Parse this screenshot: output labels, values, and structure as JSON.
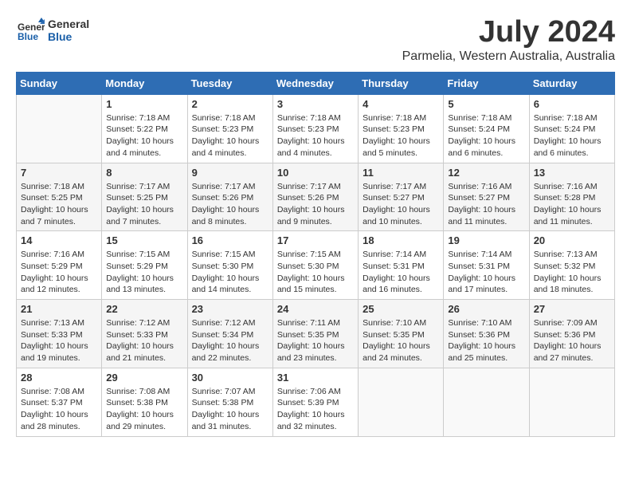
{
  "header": {
    "logo_line1": "General",
    "logo_line2": "Blue",
    "title": "July 2024",
    "subtitle": "Parmelia, Western Australia, Australia"
  },
  "weekdays": [
    "Sunday",
    "Monday",
    "Tuesday",
    "Wednesday",
    "Thursday",
    "Friday",
    "Saturday"
  ],
  "weeks": [
    [
      {
        "day": "",
        "info": ""
      },
      {
        "day": "1",
        "info": "Sunrise: 7:18 AM\nSunset: 5:22 PM\nDaylight: 10 hours\nand 4 minutes."
      },
      {
        "day": "2",
        "info": "Sunrise: 7:18 AM\nSunset: 5:23 PM\nDaylight: 10 hours\nand 4 minutes."
      },
      {
        "day": "3",
        "info": "Sunrise: 7:18 AM\nSunset: 5:23 PM\nDaylight: 10 hours\nand 4 minutes."
      },
      {
        "day": "4",
        "info": "Sunrise: 7:18 AM\nSunset: 5:23 PM\nDaylight: 10 hours\nand 5 minutes."
      },
      {
        "day": "5",
        "info": "Sunrise: 7:18 AM\nSunset: 5:24 PM\nDaylight: 10 hours\nand 6 minutes."
      },
      {
        "day": "6",
        "info": "Sunrise: 7:18 AM\nSunset: 5:24 PM\nDaylight: 10 hours\nand 6 minutes."
      }
    ],
    [
      {
        "day": "7",
        "info": "Sunrise: 7:18 AM\nSunset: 5:25 PM\nDaylight: 10 hours\nand 7 minutes."
      },
      {
        "day": "8",
        "info": "Sunrise: 7:17 AM\nSunset: 5:25 PM\nDaylight: 10 hours\nand 7 minutes."
      },
      {
        "day": "9",
        "info": "Sunrise: 7:17 AM\nSunset: 5:26 PM\nDaylight: 10 hours\nand 8 minutes."
      },
      {
        "day": "10",
        "info": "Sunrise: 7:17 AM\nSunset: 5:26 PM\nDaylight: 10 hours\nand 9 minutes."
      },
      {
        "day": "11",
        "info": "Sunrise: 7:17 AM\nSunset: 5:27 PM\nDaylight: 10 hours\nand 10 minutes."
      },
      {
        "day": "12",
        "info": "Sunrise: 7:16 AM\nSunset: 5:27 PM\nDaylight: 10 hours\nand 11 minutes."
      },
      {
        "day": "13",
        "info": "Sunrise: 7:16 AM\nSunset: 5:28 PM\nDaylight: 10 hours\nand 11 minutes."
      }
    ],
    [
      {
        "day": "14",
        "info": "Sunrise: 7:16 AM\nSunset: 5:29 PM\nDaylight: 10 hours\nand 12 minutes."
      },
      {
        "day": "15",
        "info": "Sunrise: 7:15 AM\nSunset: 5:29 PM\nDaylight: 10 hours\nand 13 minutes."
      },
      {
        "day": "16",
        "info": "Sunrise: 7:15 AM\nSunset: 5:30 PM\nDaylight: 10 hours\nand 14 minutes."
      },
      {
        "day": "17",
        "info": "Sunrise: 7:15 AM\nSunset: 5:30 PM\nDaylight: 10 hours\nand 15 minutes."
      },
      {
        "day": "18",
        "info": "Sunrise: 7:14 AM\nSunset: 5:31 PM\nDaylight: 10 hours\nand 16 minutes."
      },
      {
        "day": "19",
        "info": "Sunrise: 7:14 AM\nSunset: 5:31 PM\nDaylight: 10 hours\nand 17 minutes."
      },
      {
        "day": "20",
        "info": "Sunrise: 7:13 AM\nSunset: 5:32 PM\nDaylight: 10 hours\nand 18 minutes."
      }
    ],
    [
      {
        "day": "21",
        "info": "Sunrise: 7:13 AM\nSunset: 5:33 PM\nDaylight: 10 hours\nand 19 minutes."
      },
      {
        "day": "22",
        "info": "Sunrise: 7:12 AM\nSunset: 5:33 PM\nDaylight: 10 hours\nand 21 minutes."
      },
      {
        "day": "23",
        "info": "Sunrise: 7:12 AM\nSunset: 5:34 PM\nDaylight: 10 hours\nand 22 minutes."
      },
      {
        "day": "24",
        "info": "Sunrise: 7:11 AM\nSunset: 5:35 PM\nDaylight: 10 hours\nand 23 minutes."
      },
      {
        "day": "25",
        "info": "Sunrise: 7:10 AM\nSunset: 5:35 PM\nDaylight: 10 hours\nand 24 minutes."
      },
      {
        "day": "26",
        "info": "Sunrise: 7:10 AM\nSunset: 5:36 PM\nDaylight: 10 hours\nand 25 minutes."
      },
      {
        "day": "27",
        "info": "Sunrise: 7:09 AM\nSunset: 5:36 PM\nDaylight: 10 hours\nand 27 minutes."
      }
    ],
    [
      {
        "day": "28",
        "info": "Sunrise: 7:08 AM\nSunset: 5:37 PM\nDaylight: 10 hours\nand 28 minutes."
      },
      {
        "day": "29",
        "info": "Sunrise: 7:08 AM\nSunset: 5:38 PM\nDaylight: 10 hours\nand 29 minutes."
      },
      {
        "day": "30",
        "info": "Sunrise: 7:07 AM\nSunset: 5:38 PM\nDaylight: 10 hours\nand 31 minutes."
      },
      {
        "day": "31",
        "info": "Sunrise: 7:06 AM\nSunset: 5:39 PM\nDaylight: 10 hours\nand 32 minutes."
      },
      {
        "day": "",
        "info": ""
      },
      {
        "day": "",
        "info": ""
      },
      {
        "day": "",
        "info": ""
      }
    ]
  ]
}
